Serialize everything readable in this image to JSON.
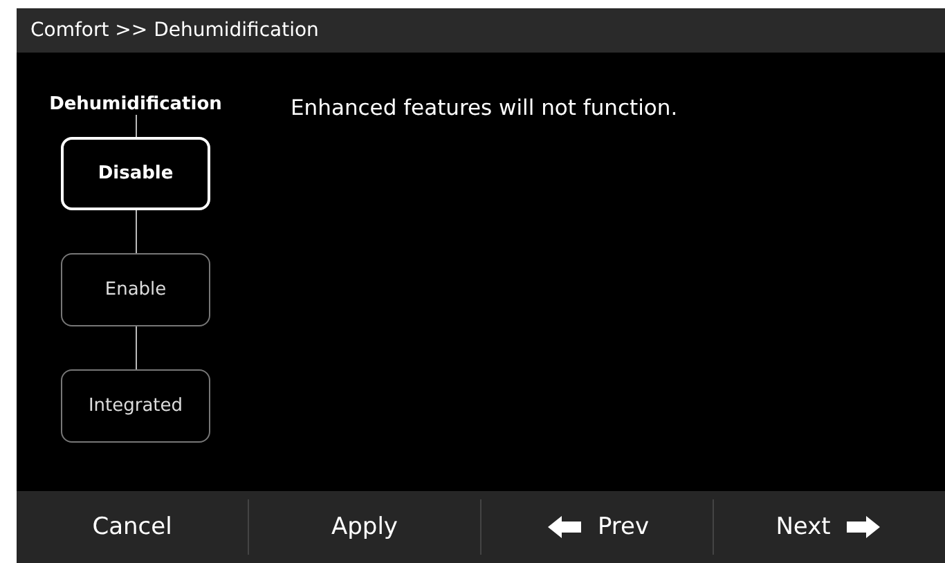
{
  "header": {
    "title": "Comfort >> Dehumidification"
  },
  "options": {
    "title": "Dehumidification",
    "items": [
      {
        "label": "Disable",
        "selected": true
      },
      {
        "label": "Enable",
        "selected": false
      },
      {
        "label": "Integrated",
        "selected": false
      }
    ]
  },
  "message": "Enhanced features will not function.",
  "footer": {
    "buttons": [
      {
        "label": "Cancel",
        "kind": "plain"
      },
      {
        "label": "Apply",
        "kind": "plain"
      },
      {
        "label": "Prev",
        "kind": "back"
      },
      {
        "label": "Next",
        "kind": "forward"
      }
    ]
  }
}
